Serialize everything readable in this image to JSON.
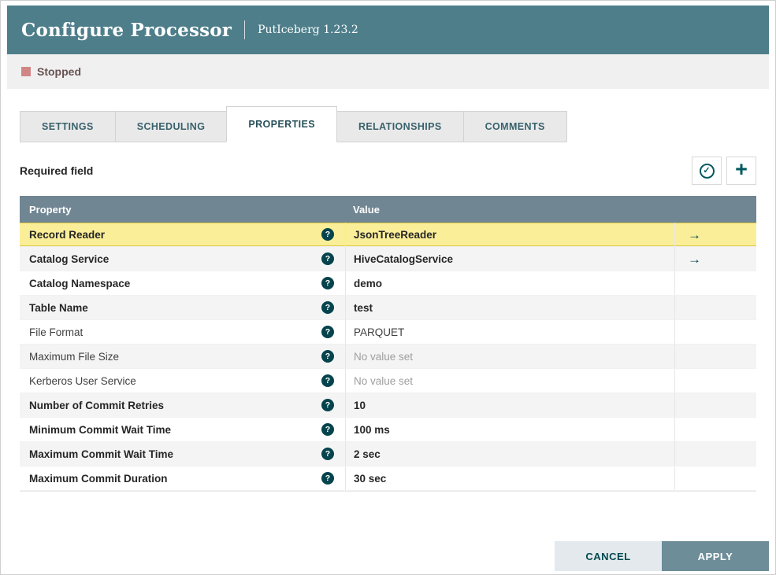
{
  "colors": {
    "header_bg": "#4d7e8a",
    "table_header_bg": "#718693",
    "accent_teal": "#00585f",
    "selected_row_bg": "#faee98",
    "stopped_red": "#d18686",
    "apply_bg": "#6d8d99"
  },
  "header": {
    "title": "Configure Processor",
    "subtitle": "PutIceberg 1.23.2"
  },
  "status": {
    "label": "Stopped"
  },
  "tabs": [
    {
      "label": "SETTINGS"
    },
    {
      "label": "SCHEDULING"
    },
    {
      "label": "PROPERTIES",
      "active": true
    },
    {
      "label": "RELATIONSHIPS"
    },
    {
      "label": "COMMENTS"
    }
  ],
  "toolbar": {
    "required_field_label": "Required field"
  },
  "icons": {
    "help": "?",
    "check": "✓",
    "add_plus": "+",
    "goto_arrow": "→"
  },
  "table": {
    "columns": [
      "Property",
      "Value"
    ],
    "rows": [
      {
        "property": "Record Reader",
        "value": "JsonTreeReader",
        "required": true,
        "unset": false,
        "selected": true,
        "has_goto": true
      },
      {
        "property": "Catalog Service",
        "value": "HiveCatalogService",
        "required": true,
        "unset": false,
        "selected": false,
        "has_goto": true
      },
      {
        "property": "Catalog Namespace",
        "value": "demo",
        "required": true,
        "unset": false,
        "selected": false,
        "has_goto": false
      },
      {
        "property": "Table Name",
        "value": "test",
        "required": true,
        "unset": false,
        "selected": false,
        "has_goto": false
      },
      {
        "property": "File Format",
        "value": "PARQUET",
        "required": false,
        "unset": false,
        "selected": false,
        "has_goto": false
      },
      {
        "property": "Maximum File Size",
        "value": "No value set",
        "required": false,
        "unset": true,
        "selected": false,
        "has_goto": false
      },
      {
        "property": "Kerberos User Service",
        "value": "No value set",
        "required": false,
        "unset": true,
        "selected": false,
        "has_goto": false
      },
      {
        "property": "Number of Commit Retries",
        "value": "10",
        "required": true,
        "unset": false,
        "selected": false,
        "has_goto": false
      },
      {
        "property": "Minimum Commit Wait Time",
        "value": "100 ms",
        "required": true,
        "unset": false,
        "selected": false,
        "has_goto": false
      },
      {
        "property": "Maximum Commit Wait Time",
        "value": "2 sec",
        "required": true,
        "unset": false,
        "selected": false,
        "has_goto": false
      },
      {
        "property": "Maximum Commit Duration",
        "value": "30 sec",
        "required": true,
        "unset": false,
        "selected": false,
        "has_goto": false
      }
    ]
  },
  "footer": {
    "cancel_label": "CANCEL",
    "apply_label": "APPLY"
  }
}
